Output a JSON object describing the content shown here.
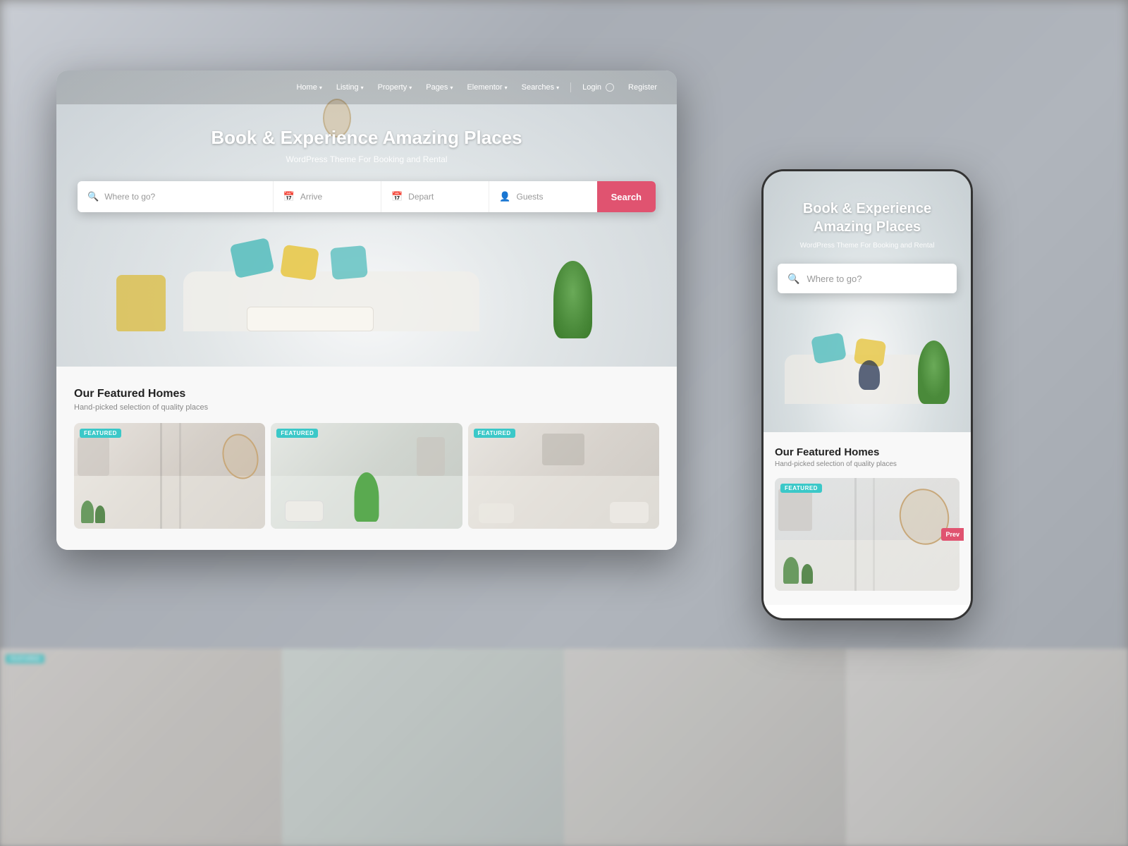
{
  "background": {
    "color": "#888888"
  },
  "desktop": {
    "navbar": {
      "items": [
        {
          "label": "Home",
          "hasDropdown": true
        },
        {
          "label": "Listing",
          "hasDropdown": true
        },
        {
          "label": "Property",
          "hasDropdown": true
        },
        {
          "label": "Pages",
          "hasDropdown": true
        },
        {
          "label": "Elementor",
          "hasDropdown": true
        },
        {
          "label": "Searches",
          "hasDropdown": true
        },
        {
          "label": "Login"
        },
        {
          "label": "Register"
        }
      ]
    },
    "hero": {
      "title": "Book & Experience Amazing Places",
      "subtitle": "WordPress Theme For Booking and Rental",
      "search": {
        "placeholder": "Where to go?",
        "arrive_label": "Arrive",
        "depart_label": "Depart",
        "guests_label": "Guests",
        "button_label": "Search"
      }
    },
    "featured": {
      "title": "Our Featured Homes",
      "subtitle": "Hand-picked selection of quality places",
      "badge_label": "FEATURED",
      "cards": [
        {
          "id": 1
        },
        {
          "id": 2
        },
        {
          "id": 3
        }
      ]
    }
  },
  "mobile": {
    "hero": {
      "title": "Book & Experience Amazing Places",
      "subtitle": "WordPress Theme For Booking and Rental",
      "search": {
        "placeholder": "Where to go?"
      }
    },
    "featured": {
      "title": "Our Featured Homes",
      "subtitle": "Hand-picked selection of quality places",
      "badge_label": "FEATURED",
      "prev_label": "Prev"
    }
  }
}
